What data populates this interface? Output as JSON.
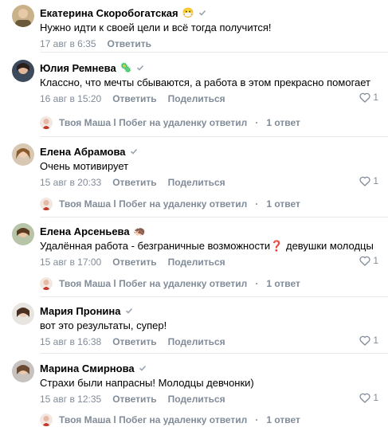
{
  "actions": {
    "reply": "Ответить",
    "delete": "Поделиться"
  },
  "comments": [
    {
      "name": "Екатерина Скоробогатская",
      "emoji": "😷",
      "text": "Нужно идти к своей цели и всё тогда получится!",
      "date": "17 авг в 6:35",
      "likes": "",
      "reply": ""
    },
    {
      "name": "Юлия Ремнева",
      "emoji": "🦠",
      "text": "Классно, что мечты сбываются, а работа в этом прекрасно помогает",
      "date": "16 авг в 15:20",
      "likes": "1",
      "reply": "Твоя Маша l Побег на удаленку ответил",
      "reply_count": "1 ответ"
    },
    {
      "name": "Елена Абрамова",
      "emoji": "",
      "text": "Очень мотивирует",
      "date": "15 авг в 20:33",
      "likes": "1",
      "reply": "Твоя Маша l Побег на удаленку ответил",
      "reply_count": "1 ответ"
    },
    {
      "name": "Елена Арсеньева",
      "emoji": "🦔",
      "text": "Удалённая работа - безграничные возможности❓ девушки молодцы",
      "date": "15 авг в 17:00",
      "likes": "1",
      "reply": "Твоя Маша l Побег на удаленку ответил",
      "reply_count": "1 ответ"
    },
    {
      "name": "Мария Пронина",
      "emoji": "",
      "text": "вот это результаты, супер!",
      "date": "15 авг в 16:38",
      "likes": "1",
      "reply": ""
    },
    {
      "name": "Марина Смирнова",
      "emoji": "",
      "text": "Страхи были напрасны! Молодцы девчонки)",
      "date": "15 авг в 12:35",
      "likes": "1",
      "reply": "Твоя Маша l Побег на удаленку ответил",
      "reply_count": "1 ответ"
    }
  ]
}
